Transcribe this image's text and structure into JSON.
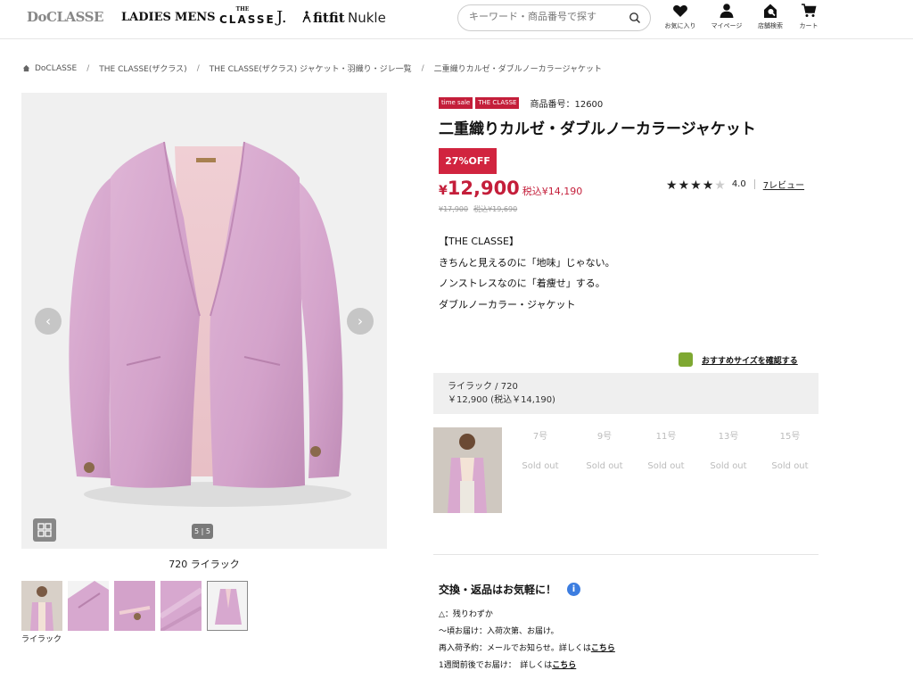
{
  "header": {
    "logo": "DoCLASSE",
    "nav": [
      "LADIES",
      "MENS"
    ],
    "brand_classe_top": "THE",
    "brand_classe_bottom": "CLASSE",
    "brand_j": "J.",
    "brand_fitfit": "fitfit",
    "brand_nukle": "Nukle",
    "search_placeholder": "キーワード・商品番号で探す",
    "icons": [
      {
        "name": "heart-icon",
        "label": "お気に入り"
      },
      {
        "name": "user-icon",
        "label": "マイページ"
      },
      {
        "name": "store-search-icon",
        "label": "店舗検索"
      },
      {
        "name": "cart-icon",
        "label": "カート"
      }
    ]
  },
  "breadcrumb": [
    "DoCLASSE",
    "THE CLASSE(ザクラス)",
    "THE CLASSE(ザクラス) ジャケット・羽織り・ジレ一覧",
    "二重織りカルゼ・ダブルノーカラージャケット"
  ],
  "gallery": {
    "pager": "5 | 5",
    "caption": "720 ライラック",
    "thumb_label": "ライラック",
    "thumb_count": 5,
    "selected_index": 4
  },
  "product": {
    "badges": [
      "time sale",
      "THE CLASSE"
    ],
    "product_number": "商品番号：12600",
    "title": "二重織りカルゼ・ダブルノーカラージャケット",
    "discount": "27%OFF",
    "price_yen": "¥",
    "price": "12,900",
    "price_tax": "税込¥14,190",
    "old_price": "¥17,900",
    "old_price_tax": "税込¥19,690",
    "rating": 4.0,
    "rating_text": "4.0",
    "reviews": "7レビュー",
    "description": [
      "【THE CLASSE】",
      "きちんと見えるのに「地味」じゃない。",
      "ノンストレスなのに「着痩せ」する。",
      "ダブルノーカラー・ジャケット"
    ],
    "size_check": "おすすめサイズを確認する",
    "color_name": "ライラック / 720",
    "color_price": "￥12,900 (税込￥14,190)",
    "sizes": [
      {
        "size": "7号",
        "status": "Sold out"
      },
      {
        "size": "9号",
        "status": "Sold out"
      },
      {
        "size": "11号",
        "status": "Sold out"
      },
      {
        "size": "13号",
        "status": "Sold out"
      },
      {
        "size": "15号",
        "status": "Sold out"
      }
    ]
  },
  "info": {
    "heading": "交換・返品はお気軽に！",
    "line1": "△：残りわずか",
    "line2": "〜頃お届け：入荷次第、お届け。",
    "line3_text": "再入荷予約：メールでお知らせ。詳しくは",
    "line3_link": "こちら",
    "line4_text": "1週間前後でお届け：　詳しくは",
    "line4_link": "こちら"
  },
  "colors": {
    "accent": "#c41e3a",
    "jacket": "#d7a8cf",
    "info_blue": "#3c7de0",
    "size_icon_green": "#7ea832"
  }
}
